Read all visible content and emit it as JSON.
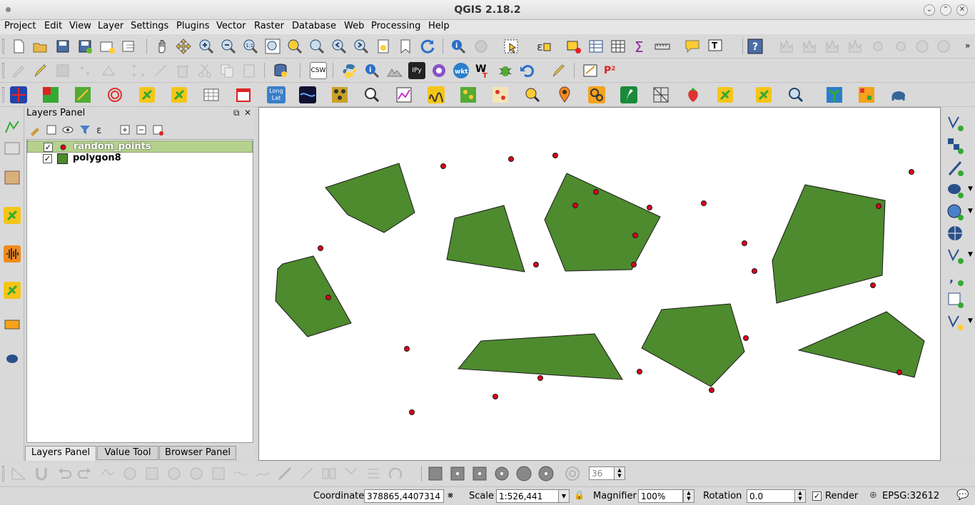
{
  "window": {
    "title": "QGIS 2.18.2"
  },
  "menu": [
    "Project",
    "Edit",
    "View",
    "Layer",
    "Settings",
    "Plugins",
    "Vector",
    "Raster",
    "Database",
    "Web",
    "Processing",
    "Help"
  ],
  "layers_panel": {
    "title": "Layers Panel",
    "layers": [
      {
        "name": "random_points",
        "checked": true,
        "selected": true,
        "symbol": "point-symbol-icon"
      },
      {
        "name": "polygon8",
        "checked": true,
        "selected": false,
        "symbol": "polygon-symbol-icon"
      }
    ]
  },
  "tabs": [
    "Layers Panel",
    "Value Tool",
    "Browser Panel"
  ],
  "toolbar_extra": {
    "csw_label": "CSW",
    "wkt_label": "wkt",
    "longlat_label": "Long Lat",
    "p2_label": "P²",
    "ipy_label": "IPy"
  },
  "bottom_toolbar": {
    "tolerance_value": "36"
  },
  "status": {
    "coordinate_label": "Coordinate",
    "coordinate_value": "378865,4407314",
    "scale_label": "Scale",
    "scale_value": "1:526,441",
    "magnifier_label": "Magnifier",
    "magnifier_value": "100%",
    "rotation_label": "Rotation",
    "rotation_value": "0.0",
    "render_label": "Render",
    "crs_label": "EPSG:32612"
  },
  "colors": {
    "polygon_fill": "#4e8a2e",
    "point_fill": "#e0001b",
    "selection": "#b5d18d"
  }
}
